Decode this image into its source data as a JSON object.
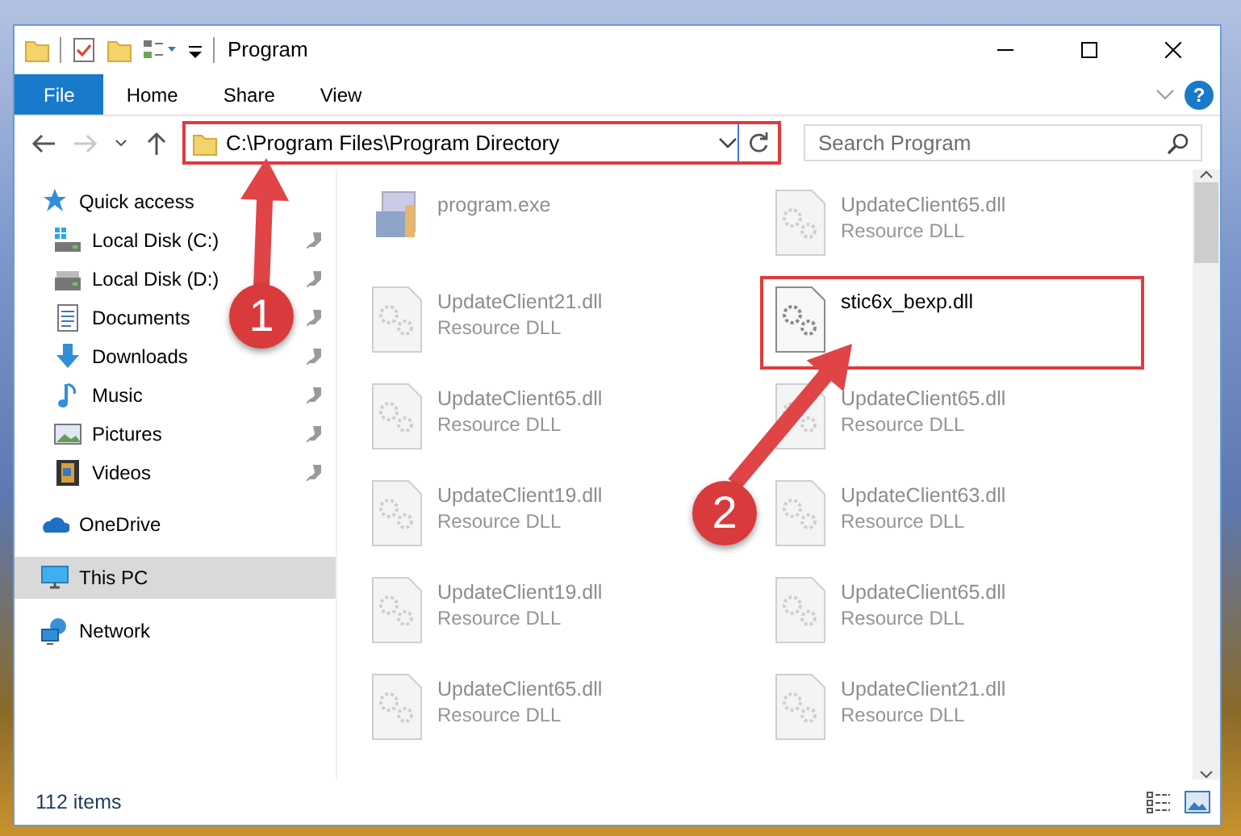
{
  "window": {
    "title": "Program"
  },
  "ribbon": {
    "tabs": [
      {
        "label": "File",
        "selected": true
      },
      {
        "label": "Home",
        "selected": false
      },
      {
        "label": "Share",
        "selected": false
      },
      {
        "label": "View",
        "selected": false
      }
    ],
    "help": "?"
  },
  "address_bar": {
    "path": "C:\\Program Files\\Program Directory",
    "highlighted": true
  },
  "search": {
    "placeholder": "Search Program"
  },
  "navigation": [
    {
      "label": "Quick access",
      "kind": "star",
      "selected": false,
      "children": [
        {
          "label": "Local Disk (C:)",
          "kind": "system-drive",
          "pinned": true,
          "selected": false
        },
        {
          "label": "Local Disk (D:)",
          "kind": "drive",
          "pinned": true,
          "selected": false
        },
        {
          "label": "Documents",
          "kind": "documents",
          "pinned": true,
          "selected": false
        },
        {
          "label": "Downloads",
          "kind": "downloads",
          "pinned": true,
          "selected": false
        },
        {
          "label": "Music",
          "kind": "music",
          "pinned": true,
          "selected": false
        },
        {
          "label": "Pictures",
          "kind": "pictures",
          "pinned": true,
          "selected": false
        },
        {
          "label": "Videos",
          "kind": "videos",
          "pinned": true,
          "selected": false
        }
      ]
    },
    {
      "label": "OneDrive",
      "kind": "cloud",
      "selected": false
    },
    {
      "label": "This PC",
      "kind": "computer",
      "selected": true
    },
    {
      "label": "Network",
      "kind": "network",
      "selected": false
    }
  ],
  "files": [
    {
      "name": "program.exe",
      "kind": "exe",
      "dimmed": true,
      "highlighted": false
    },
    {
      "name": "UpdateClient65.dll",
      "type": "Resource DLL",
      "kind": "dll",
      "dimmed": true,
      "highlighted": false
    },
    {
      "name": "UpdateClient21.dll",
      "type": "Resource DLL",
      "kind": "dll",
      "dimmed": true,
      "highlighted": false
    },
    {
      "name": "stic6x_bexp.dll",
      "kind": "dll",
      "dimmed": false,
      "highlighted": true
    },
    {
      "name": "UpdateClient65.dll",
      "type": "Resource DLL",
      "kind": "dll",
      "dimmed": true,
      "highlighted": false
    },
    {
      "name": "UpdateClient65.dll",
      "type": "Resource DLL",
      "kind": "dll",
      "dimmed": true,
      "highlighted": false
    },
    {
      "name": "UpdateClient19.dll",
      "type": "Resource DLL",
      "kind": "dll",
      "dimmed": true,
      "highlighted": false
    },
    {
      "name": "UpdateClient63.dll",
      "type": "Resource DLL",
      "kind": "dll",
      "dimmed": true,
      "highlighted": false
    },
    {
      "name": "UpdateClient19.dll",
      "type": "Resource DLL",
      "kind": "dll",
      "dimmed": true,
      "highlighted": false
    },
    {
      "name": "UpdateClient65.dll",
      "type": "Resource DLL",
      "kind": "dll",
      "dimmed": true,
      "highlighted": false
    },
    {
      "name": "UpdateClient65.dll",
      "type": "Resource DLL",
      "kind": "dll",
      "dimmed": true,
      "highlighted": false
    },
    {
      "name": "UpdateClient21.dll",
      "type": "Resource DLL",
      "kind": "dll",
      "dimmed": true,
      "highlighted": false
    }
  ],
  "annotations": [
    {
      "number": "1"
    },
    {
      "number": "2"
    }
  ],
  "status_bar": {
    "item_count": "112 items"
  }
}
